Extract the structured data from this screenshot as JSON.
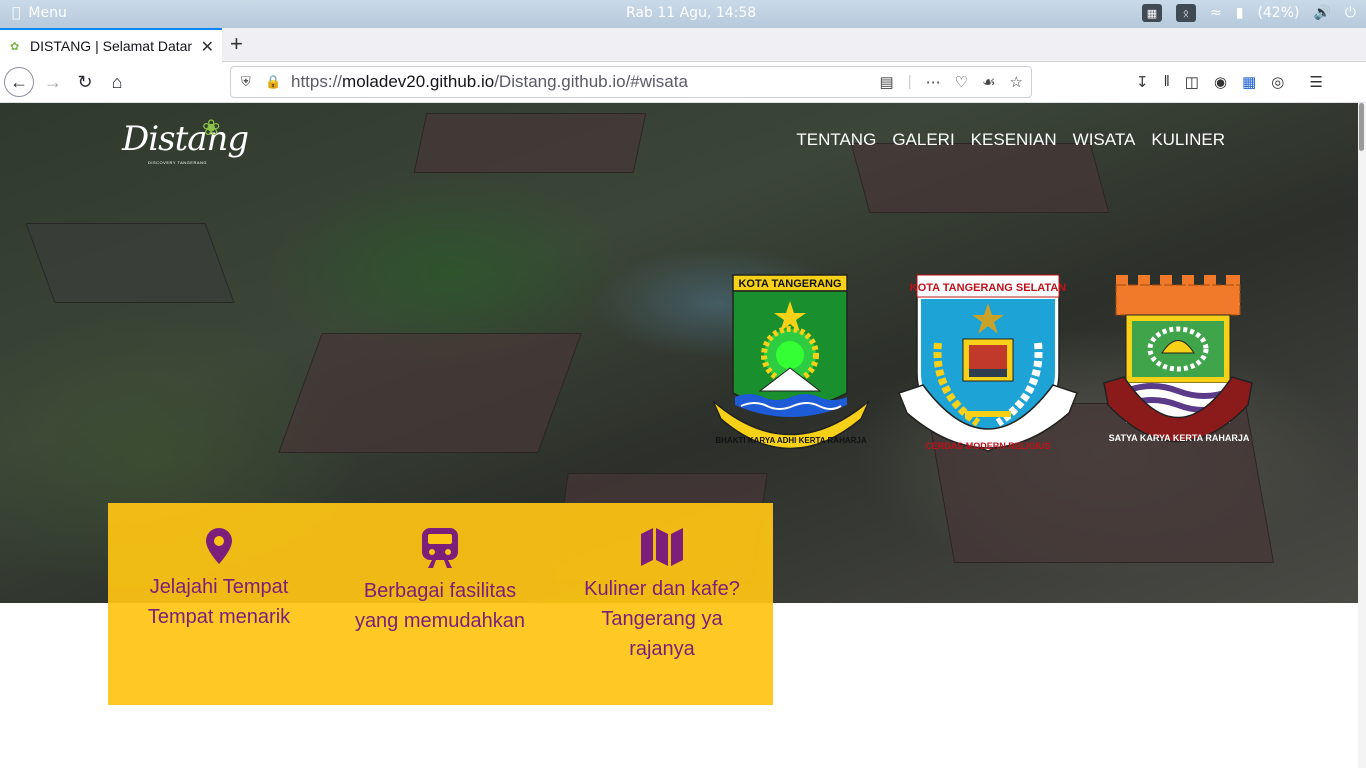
{
  "system_bar": {
    "menu_label": "Menu",
    "clock": "Rab 11 Agu, 14:58",
    "battery": "(42%)"
  },
  "browser": {
    "tab_title": "DISTANG | Selamat Datang",
    "url_prefix": "https://",
    "url_host": "moladev20.github.io",
    "url_path": "/Distang.github.io/#wisata"
  },
  "site": {
    "logo_text": "Distang",
    "logo_subtitle": "DISCOVERY TANGERANG",
    "nav": [
      "TENTANG",
      "GALERI",
      "KESENIAN",
      "WISATA",
      "KULINER"
    ],
    "crests": [
      {
        "top": "KOTA TANGERANG",
        "motto": "BHAKTI KARYA ADHI KERTA RAHARJA"
      },
      {
        "top": "KOTA TANGERANG SELATAN",
        "motto": "CERDAS MODERN RELIGIUS"
      },
      {
        "top": "",
        "motto": "SATYA KARYA KERTA RAHARJA"
      }
    ],
    "features": [
      {
        "icon": "map-pin-icon",
        "line1": "Jelajahi Tempat",
        "line2": "Tempat menarik",
        "line3": ""
      },
      {
        "icon": "train-icon",
        "line1": "Berbagai fasilitas",
        "line2": "yang memudahkan",
        "line3": ""
      },
      {
        "icon": "map-icon",
        "line1": "Kuliner dan kafe?",
        "line2": "Tangerang ya",
        "line3": "rajanya"
      }
    ]
  },
  "colors": {
    "card": "#FEC513",
    "feature_text": "#7B1F7A",
    "tab_accent": "#0A84FF"
  }
}
